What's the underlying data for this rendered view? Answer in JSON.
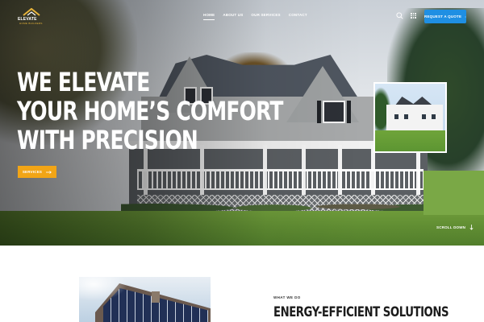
{
  "brand": {
    "name": "ELEVATE",
    "tagline": "HOME BUILDERS"
  },
  "nav": {
    "items": [
      {
        "label": "HOME",
        "active": true
      },
      {
        "label": "ABOUT US",
        "active": false
      },
      {
        "label": "OUR SERVICES",
        "active": false
      },
      {
        "label": "CONTACT",
        "active": false
      }
    ],
    "cta_label": "REQUEST A QUOTE"
  },
  "hero": {
    "headline_lines": [
      "WE ELEVATE",
      "YOUR HOME’S COMFORT",
      "WITH PRECISION"
    ],
    "button_label": "SERVICES",
    "scroll_label": "SCROLL DOWN"
  },
  "section": {
    "eyebrow": "WHAT WE DO",
    "title": "ENERGY-EFFICIENT SOLUTIONS"
  },
  "colors": {
    "accent": "#f2a516",
    "cta": "#1f8fe3",
    "logo_gold": "#e7b43a"
  },
  "icons": {
    "search": "search-icon",
    "menu": "grid-menu-icon",
    "arrow": "arrow-right-icon",
    "scroll": "arrow-down-icon"
  }
}
